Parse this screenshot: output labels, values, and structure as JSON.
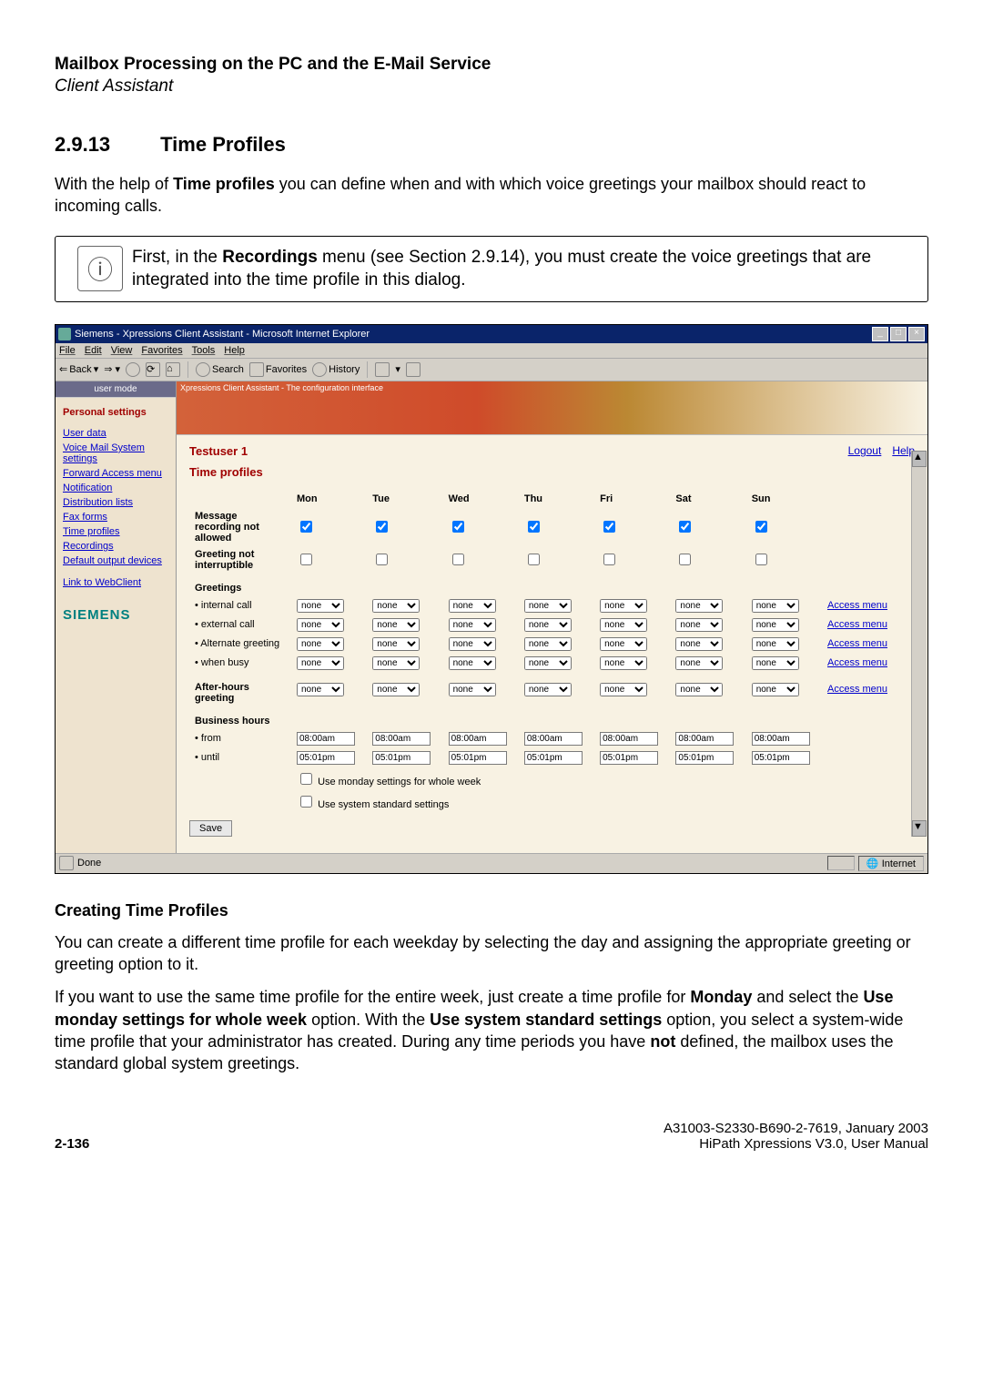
{
  "doc": {
    "header_title": "Mailbox Processing on the PC and the E-Mail Service",
    "header_subtitle": "Client Assistant",
    "section_number": "2.9.13",
    "section_title": "Time Profiles",
    "intro": "With the help of Time profiles you can define when and with which voice greetings your mailbox should react to incoming calls.",
    "info_prefix": "First, in the ",
    "info_bold": "Recordings",
    "info_suffix": " menu (see Section 2.9.14), you must create the voice greetings that are integrated into the time profile in this dialog.",
    "subheading": "Creating Time Profiles",
    "para2": "You can create a different time profile for each weekday by selecting the day and assigning the appropriate greeting or greeting option to it.",
    "para3_pre": "If you want to use the same time profile for the entire week, just create a time profile for ",
    "para3_b1": "Monday",
    "para3_mid1": " and select the ",
    "para3_b2": "Use monday settings for whole week",
    "para3_mid2": " option. With the ",
    "para3_b3": "Use system standard settings",
    "para3_mid3": " option, you select a system-wide time profile that your administrator has created. During any time periods you have ",
    "para3_b4": "not",
    "para3_end": " defined, the mailbox uses the standard global system greetings.",
    "footer_id": "A31003-S2330-B690-2-7619, January 2003",
    "footer_doc": "HiPath Xpressions V3.0, User Manual",
    "page": "2-136"
  },
  "ie": {
    "title": "Siemens - Xpressions Client Assistant - Microsoft Internet Explorer",
    "menu": [
      "File",
      "Edit",
      "View",
      "Favorites",
      "Tools",
      "Help"
    ],
    "toolbar": {
      "back": "Back",
      "search": "Search",
      "favorites": "Favorites",
      "history": "History"
    },
    "status_left": "Done",
    "status_right": "Internet"
  },
  "app": {
    "user_mode": "user mode",
    "panel_title": "Personal settings",
    "sidebar_links": [
      "User data",
      "Voice Mail System settings",
      "Forward Access menu",
      "Notification",
      "Distribution lists",
      "Fax forms",
      "Time profiles",
      "Recordings",
      "Default output devices",
      "Link to WebClient"
    ],
    "brand": "SIEMENS",
    "banner_label": "Xpressions Client Assistant - The configuration interface",
    "username": "Testuser 1",
    "logout": "Logout",
    "help": "Help",
    "section": "Time profiles",
    "days": [
      "Mon",
      "Tue",
      "Wed",
      "Thu",
      "Fri",
      "Sat",
      "Sun"
    ],
    "rows": {
      "msg_rec": "Message recording not allowed",
      "greet_int": "Greeting not interruptible",
      "greetings": "Greetings",
      "internal": "• internal call",
      "external": "• external call",
      "alternate": "• Alternate greeting",
      "busy": "• when busy",
      "afterhours": "After-hours greeting",
      "business": "Business hours",
      "from": "• from",
      "until": "• until"
    },
    "select_value": "none",
    "access_menu": "Access menu",
    "time_from": "08:00am",
    "time_until": "05:01pm",
    "opt1": "Use monday settings for whole week",
    "opt2": "Use system standard settings",
    "save": "Save"
  }
}
